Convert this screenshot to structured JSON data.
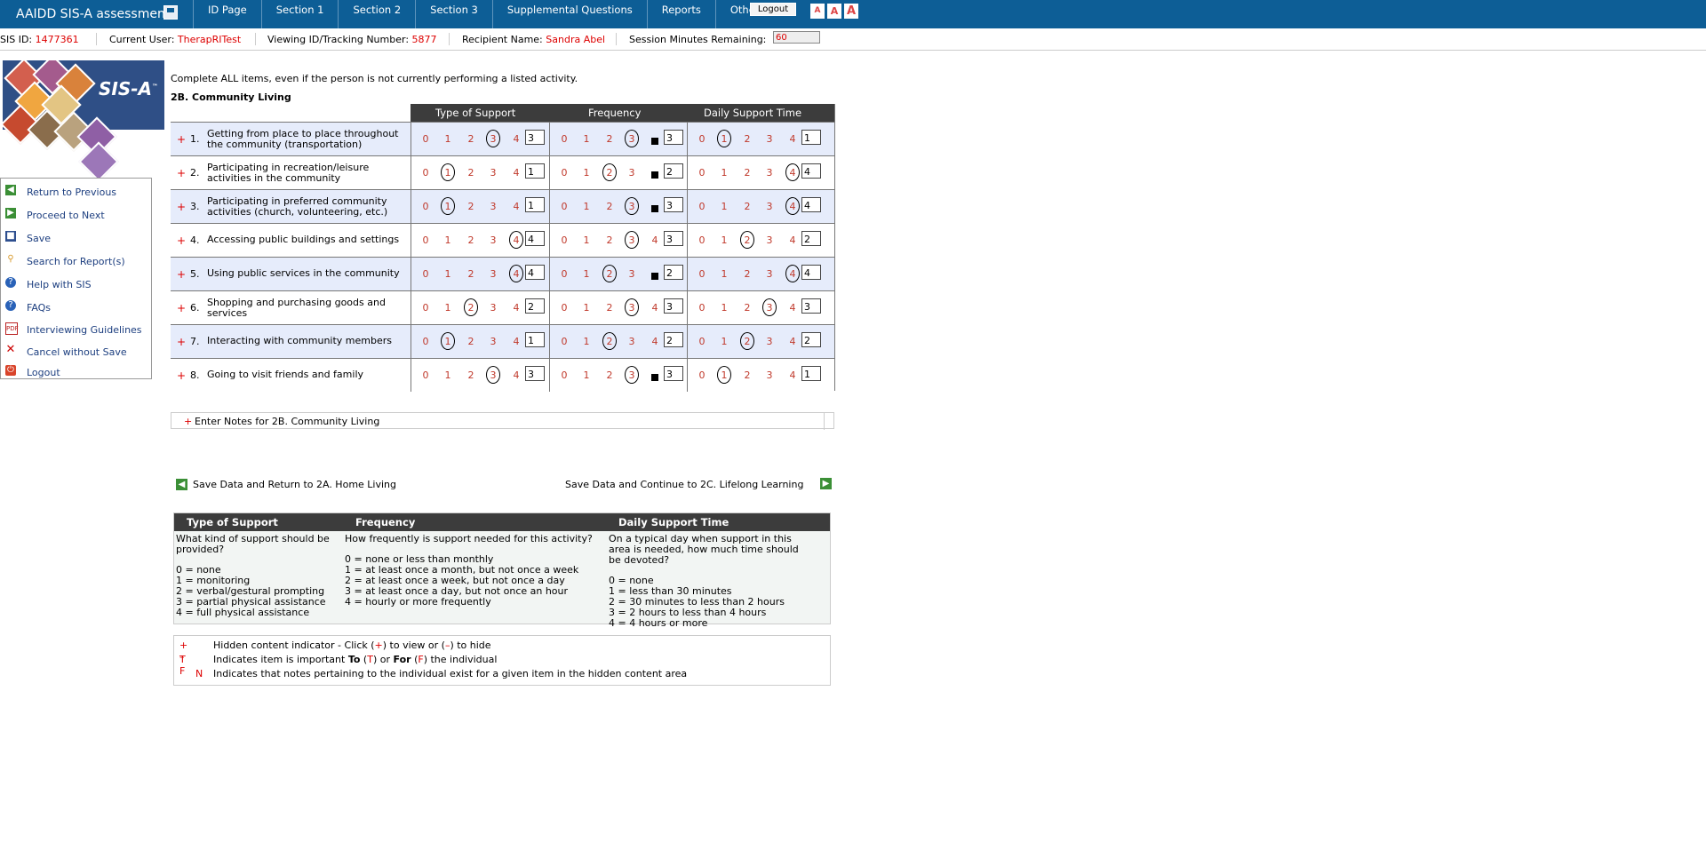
{
  "app": {
    "title": "AAIDD SIS-A assessment."
  },
  "nav": {
    "items": [
      "ID Page",
      "Section 1",
      "Section 2",
      "Section 3",
      "Supplemental Questions",
      "Reports",
      "Other"
    ],
    "logout": "Logout",
    "font_sizes": [
      "A",
      "A",
      "A"
    ]
  },
  "info": {
    "sis_id_label": "SIS ID:",
    "sis_id": "1477361",
    "user_label": "Current User:",
    "user": "TherapRITest",
    "tracking_label": "Viewing ID/Tracking Number:",
    "tracking": "5877",
    "recipient_label": "Recipient Name:",
    "recipient": "Sandra Abel",
    "session_label": "Session Minutes Remaining:",
    "session_minutes": "60"
  },
  "logo": {
    "text": "SIS-A",
    "tm": "™"
  },
  "sidebar": {
    "items": [
      {
        "label": "Return to Previous",
        "icon": "arrow-left-icon"
      },
      {
        "label": "Proceed to Next",
        "icon": "arrow-right-icon"
      },
      {
        "label": "Save",
        "icon": "floppy-disk-icon"
      },
      {
        "label": "Search for Report(s)",
        "icon": "magnifier-icon"
      },
      {
        "label": "Help with SIS",
        "icon": "help-icon"
      },
      {
        "label": "FAQs",
        "icon": "help-icon"
      },
      {
        "label": "Interviewing Guidelines",
        "icon": "pdf-icon"
      },
      {
        "label": "Cancel without Save",
        "icon": "x-icon"
      },
      {
        "label": "Logout",
        "icon": "power-icon"
      }
    ]
  },
  "form": {
    "intro": "Complete ALL items, even if the person is not currently performing a listed activity.",
    "section_title": "2B. Community Living",
    "headers": {
      "type": "Type of Support",
      "frequency": "Frequency",
      "daily": "Daily Support Time"
    },
    "options": [
      "0",
      "1",
      "2",
      "3",
      "4"
    ],
    "items": [
      {
        "num": "1.",
        "text": "Getting from place to place throughout the community (transportation)",
        "type": "3",
        "frequency": "3",
        "daily": "1",
        "freq_marker": true
      },
      {
        "num": "2.",
        "text": "Participating in recreation/leisure activities in the community",
        "type": "1",
        "frequency": "2",
        "daily": "4",
        "freq_marker": true
      },
      {
        "num": "3.",
        "text": "Participating in preferred community activities (church, volunteering, etc.)",
        "type": "1",
        "frequency": "3",
        "daily": "4",
        "freq_marker": true
      },
      {
        "num": "4.",
        "text": "Accessing public buildings and settings",
        "type": "4",
        "frequency": "3",
        "daily": "2",
        "freq_marker": false
      },
      {
        "num": "5.",
        "text": "Using public services in the community",
        "type": "4",
        "frequency": "2",
        "daily": "4",
        "freq_marker": true
      },
      {
        "num": "6.",
        "text": "Shopping and purchasing goods and services",
        "type": "2",
        "frequency": "3",
        "daily": "3",
        "freq_marker": false
      },
      {
        "num": "7.",
        "text": "Interacting with community members",
        "type": "1",
        "frequency": "2",
        "daily": "2",
        "freq_marker": false
      },
      {
        "num": "8.",
        "text": "Going to visit friends and family",
        "type": "3",
        "frequency": "3",
        "daily": "1",
        "freq_marker": true
      }
    ],
    "notes_label": "Enter Notes for 2B. Community Living",
    "back_link": "Save Data and Return to 2A. Home Living",
    "next_link": "Save Data and Continue to 2C. Lifelong Learning"
  },
  "legend": {
    "type": {
      "title": "Type of Support",
      "question": "What kind of support should be provided?",
      "lines": [
        "0 = none",
        "1 = monitoring",
        "2 = verbal/gestural prompting",
        "3 = partial physical assistance",
        "4 = full physical assistance"
      ]
    },
    "frequency": {
      "title": "Frequency",
      "question": "How frequently is support needed for this activity?",
      "lines": [
        "0 = none or less than monthly",
        "1 = at least once a month, but not once a week",
        "2 = at least once a week, but not once a day",
        "3 = at least once a day, but not once an hour",
        "4 = hourly or more frequently"
      ]
    },
    "daily": {
      "title": "Daily Support Time",
      "question": "On a typical day when support in this area is needed, how much time should be devoted?",
      "lines": [
        "0 = none",
        "1 = less than 30 minutes",
        "2 = 30 minutes to less than 2 hours",
        "3 = 2 hours to less than 4 hours",
        "4 = 4 hours or more"
      ]
    }
  },
  "key": {
    "row1_marks": "+  –",
    "row1_pre": "Hidden content indicator - Click (",
    "row1_plus": "+",
    "row1_mid": ") to view or (",
    "row1_minus": "–",
    "row1_post": ") to hide",
    "row2_marks": "T  F",
    "row2_pre": "Indicates item is important ",
    "row2_to": "To",
    "row2_t": "T",
    "row2_or": " or ",
    "row2_for": "For",
    "row2_f": "F",
    "row2_post": " the individual",
    "row3_mark": "N",
    "row3_text": "Indicates that notes pertaining to the individual exist for a given item in the hidden content area"
  }
}
